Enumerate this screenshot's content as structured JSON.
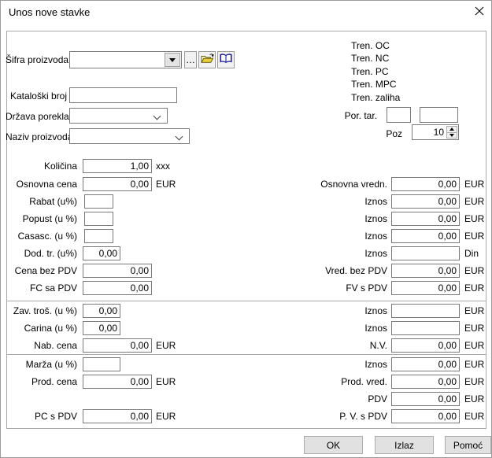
{
  "window": {
    "title": "Unos nove stavke"
  },
  "top": {
    "sifra": {
      "label": "Šifra proizvoda",
      "value": "",
      "dots_label": "…"
    },
    "kataloski": {
      "label": "Kataloški broj",
      "value": ""
    },
    "drzava": {
      "label": "Država porekla",
      "value": ""
    },
    "naziv": {
      "label": "Naziv proizvoda",
      "value": ""
    },
    "tren_labels": [
      "Tren. OC",
      "Tren. NC",
      "Tren. PC",
      "Tren. MPC",
      "Tren. zaliha"
    ],
    "por_tar": {
      "label": "Por. tar.",
      "value1": "",
      "value2": ""
    },
    "poz": {
      "label": "Poz",
      "value": "10"
    }
  },
  "sec1": {
    "left": [
      {
        "label": "Količina",
        "value": "1,00",
        "unit": "xxx"
      },
      {
        "label": "Osnovna cena",
        "value": "0,00",
        "unit": "EUR"
      },
      {
        "label": "Rabat (u%)",
        "value": ""
      },
      {
        "label": "Popust (u %)",
        "value": ""
      },
      {
        "label": "Casasc. (u %)",
        "value": ""
      },
      {
        "label": "Dod. tr. (u%)",
        "value": "0,00"
      },
      {
        "label": "Cena bez PDV",
        "value": "0,00"
      },
      {
        "label": "FC sa PDV",
        "value": "0,00"
      }
    ],
    "right": [
      {
        "label": "Osnovna vredn.",
        "value": "0,00",
        "unit": "EUR"
      },
      {
        "label": "Iznos",
        "value": "0,00",
        "unit": "EUR"
      },
      {
        "label": "Iznos",
        "value": "0,00",
        "unit": "EUR"
      },
      {
        "label": "Iznos",
        "value": "0,00",
        "unit": "EUR"
      },
      {
        "label": "Iznos",
        "value": "",
        "unit": "Din"
      },
      {
        "label": "Vred. bez PDV",
        "value": "0,00",
        "unit": "EUR"
      },
      {
        "label": "FV s PDV",
        "value": "0,00",
        "unit": "EUR"
      }
    ]
  },
  "sec2": {
    "left": [
      {
        "label": "Zav. troš. (u %)",
        "value": "0,00"
      },
      {
        "label": "Carina (u %)",
        "value": "0,00"
      },
      {
        "label": "Nab. cena",
        "value": "0,00",
        "unit": "EUR"
      }
    ],
    "right": [
      {
        "label": "Iznos",
        "value": "",
        "unit": "EUR"
      },
      {
        "label": "Iznos",
        "value": "",
        "unit": "EUR"
      },
      {
        "label": "N.V.",
        "value": "0,00",
        "unit": "EUR"
      }
    ]
  },
  "sec3": {
    "left": [
      {
        "label": "Marža (u %)",
        "value": ""
      },
      {
        "label": "Prod. cena",
        "value": "0,00",
        "unit": "EUR"
      },
      {
        "label": "PC s PDV",
        "value": "0,00",
        "unit": "EUR"
      }
    ],
    "right": [
      {
        "label": "Iznos",
        "value": "0,00",
        "unit": "EUR"
      },
      {
        "label": "Prod. vred.",
        "value": "0,00",
        "unit": "EUR"
      },
      {
        "label": "PDV",
        "value": "0,00",
        "unit": "EUR"
      },
      {
        "label": "P. V. s PDV",
        "value": "0,00",
        "unit": "EUR"
      }
    ]
  },
  "buttons": {
    "ok": "OK",
    "izlaz": "Izlaz",
    "pomoc": "Pomoć"
  },
  "colors": {
    "field_border": "#7a7a7a",
    "group_border": "#a9a9a9",
    "button_bg": "#e1e1e1",
    "button_border": "#adadad",
    "book_icon": "#15159a",
    "folder_icon": "#e8ce3a"
  }
}
